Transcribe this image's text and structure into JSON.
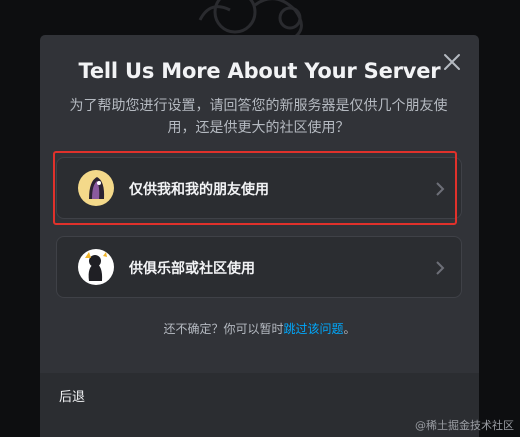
{
  "modal": {
    "title": "Tell Us More About Your Server",
    "subtitle": "为了帮助您进行设置，请回答您的新服务器是仅供几个朋友使用，还是供更大的社区使用？",
    "options": [
      {
        "label": "仅供我和我的朋友使用",
        "icon": "friends-icon"
      },
      {
        "label": "供俱乐部或社区使用",
        "icon": "community-icon"
      }
    ],
    "hint_prefix": "还不确定？你可以暂时",
    "hint_link": "跳过该问题",
    "hint_suffix": "。",
    "back_label": "后退"
  },
  "watermark": "@稀土掘金技术社区",
  "colors": {
    "modal_bg": "#313338",
    "footer_bg": "#2b2d31",
    "link": "#00a8fc",
    "highlight": "#e0312b"
  }
}
